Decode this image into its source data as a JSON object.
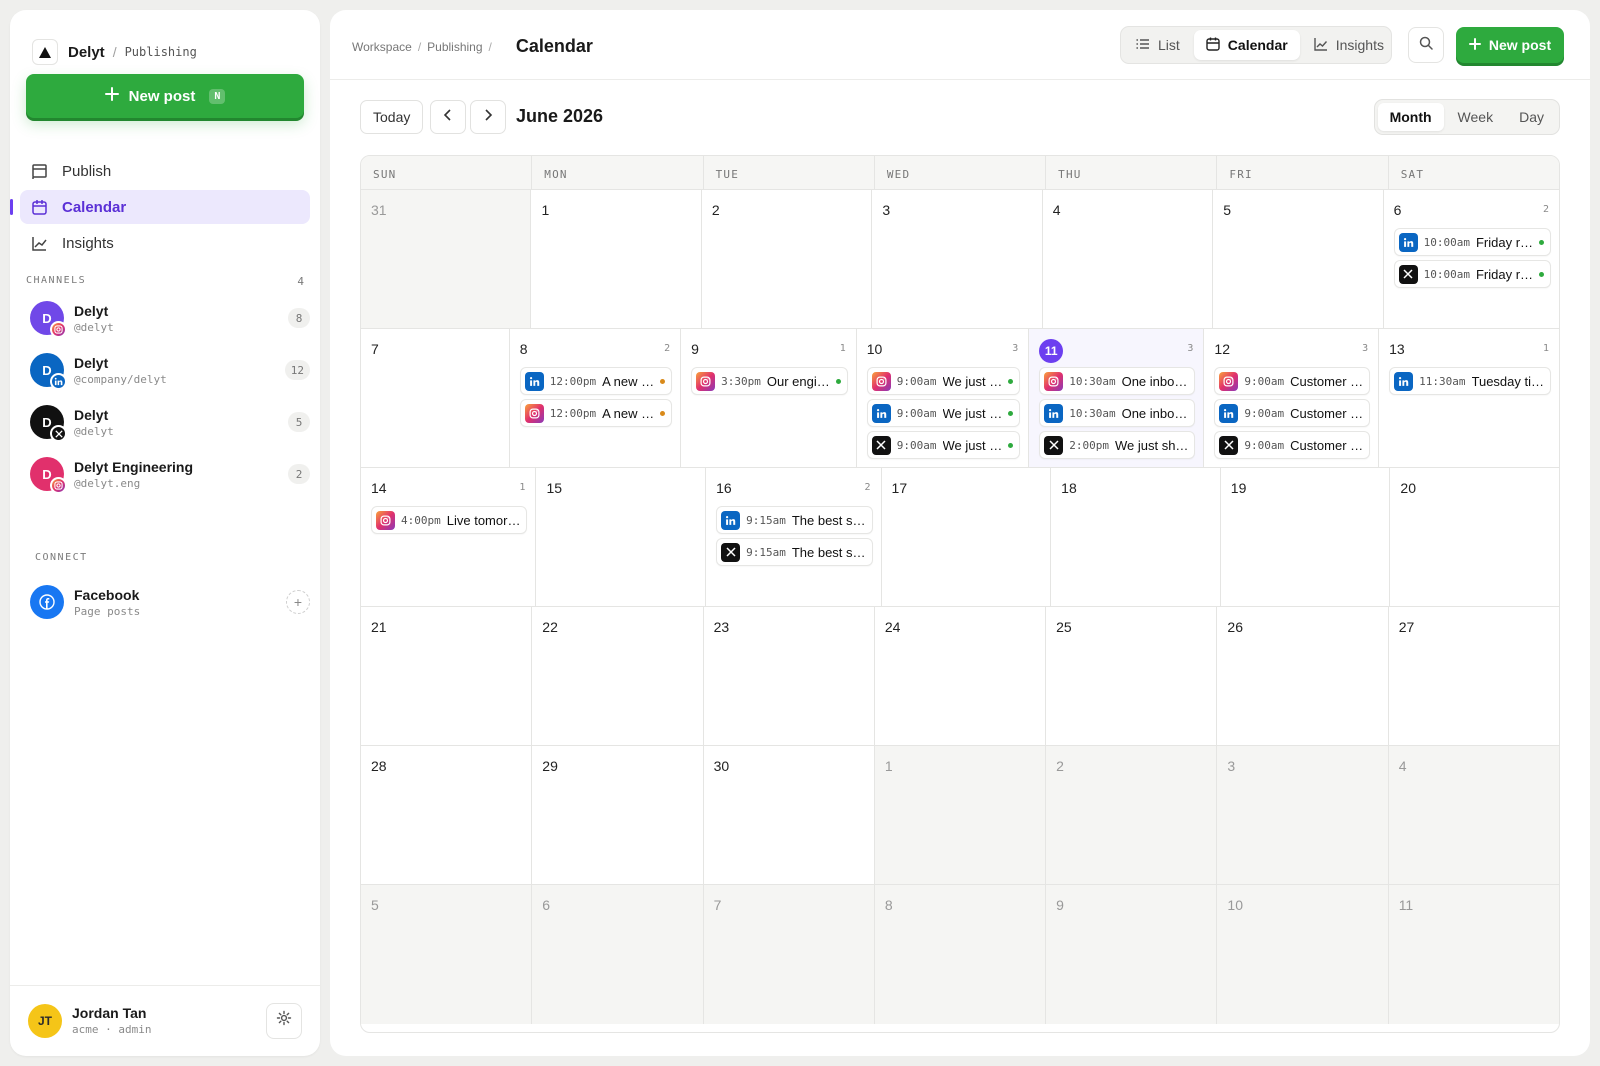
{
  "brand": {
    "name": "Delyt",
    "section": "Publishing"
  },
  "sidebar": {
    "new_post": {
      "label": "New post",
      "shortcut": "N"
    },
    "nav": [
      {
        "label": "Publish",
        "icon": "flag-icon",
        "active": false
      },
      {
        "label": "Calendar",
        "icon": "calendar-icon",
        "active": true
      },
      {
        "label": "Insights",
        "icon": "chart-icon",
        "active": false
      }
    ],
    "channels_label": "CHANNELS",
    "channels_count": "4",
    "channels": [
      {
        "name": "Delyt",
        "handle": "@delyt",
        "count": "8",
        "platform": "instagram",
        "avatar_color": "#7048e8",
        "initial": "D"
      },
      {
        "name": "Delyt",
        "handle": "@company/delyt",
        "count": "12",
        "platform": "linkedin",
        "avatar_color": "#0a66c2",
        "initial": "D"
      },
      {
        "name": "Delyt",
        "handle": "@delyt",
        "count": "5",
        "platform": "x",
        "avatar_color": "#111111",
        "initial": "D"
      },
      {
        "name": "Delyt Engineering",
        "handle": "@delyt.eng",
        "count": "2",
        "platform": "instagram",
        "avatar_color": "#e1306c",
        "initial": "D"
      }
    ],
    "connect_label": "CONNECT",
    "connect": {
      "name": "Facebook",
      "sub": "Page posts"
    },
    "user": {
      "initials": "JT",
      "name": "Jordan Tan",
      "meta": "acme · admin"
    }
  },
  "header": {
    "breadcrumb": [
      "Workspace",
      "Publishing"
    ],
    "title": "Calendar",
    "views": [
      {
        "label": "List",
        "icon": "list-icon",
        "active": false
      },
      {
        "label": "Calendar",
        "icon": "calendar-icon",
        "active": true
      },
      {
        "label": "Insights",
        "icon": "chart-icon",
        "active": false
      }
    ],
    "new_post": "New post"
  },
  "calendar": {
    "today_label": "Today",
    "month_label": "June 2026",
    "ranges": [
      {
        "label": "Month",
        "active": true
      },
      {
        "label": "Week",
        "active": false
      },
      {
        "label": "Day",
        "active": false
      }
    ],
    "weekdays": [
      "SUN",
      "MON",
      "TUE",
      "WED",
      "THU",
      "FRI",
      "SAT"
    ],
    "colors": {
      "accent": "#6c3ff0",
      "green": "#2eaa3e",
      "scheduled": "#2eaa3e",
      "draft": "#d98a1a"
    },
    "weeks": [
      [
        {
          "day": "31",
          "out": true
        },
        {
          "day": "1"
        },
        {
          "day": "2"
        },
        {
          "day": "3"
        },
        {
          "day": "4"
        },
        {
          "day": "5"
        },
        {
          "day": "6",
          "count": "2",
          "posts": [
            {
              "platform": "li",
              "time": "10:00am",
              "text": "Friday r…",
              "status": "green"
            },
            {
              "platform": "x",
              "time": "10:00am",
              "text": "Friday r…",
              "status": "green"
            }
          ]
        }
      ],
      [
        {
          "day": "7"
        },
        {
          "day": "8",
          "count": "2",
          "posts": [
            {
              "platform": "li",
              "time": "12:00pm",
              "text": "A new …",
              "status": "orange"
            },
            {
              "platform": "ig",
              "time": "12:00pm",
              "text": "A new …",
              "status": "orange"
            }
          ]
        },
        {
          "day": "9",
          "count": "1",
          "posts": [
            {
              "platform": "ig",
              "time": "3:30pm",
              "text": "Our engi…",
              "status": "green"
            }
          ]
        },
        {
          "day": "10",
          "count": "3",
          "posts": [
            {
              "platform": "ig",
              "time": "9:00am",
              "text": "We just …",
              "status": "green"
            },
            {
              "platform": "li",
              "time": "9:00am",
              "text": "We just …",
              "status": "green"
            },
            {
              "platform": "x",
              "time": "9:00am",
              "text": "We just …",
              "status": "green"
            }
          ]
        },
        {
          "day": "11",
          "today": true,
          "count": "3",
          "posts": [
            {
              "platform": "ig",
              "time": "10:30am",
              "text": "One inbo…"
            },
            {
              "platform": "li",
              "time": "10:30am",
              "text": "One inbo…"
            },
            {
              "platform": "x",
              "time": "2:00pm",
              "text": "We just sh…"
            }
          ]
        },
        {
          "day": "12",
          "count": "3",
          "posts": [
            {
              "platform": "ig",
              "time": "9:00am",
              "text": "Customer …"
            },
            {
              "platform": "li",
              "time": "9:00am",
              "text": "Customer …"
            },
            {
              "platform": "x",
              "time": "9:00am",
              "text": "Customer …"
            }
          ]
        },
        {
          "day": "13",
          "count": "1",
          "posts": [
            {
              "platform": "li",
              "time": "11:30am",
              "text": "Tuesday ti…"
            }
          ]
        }
      ],
      [
        {
          "day": "14",
          "count": "1",
          "posts": [
            {
              "platform": "ig",
              "time": "4:00pm",
              "text": "Live tomor…"
            }
          ]
        },
        {
          "day": "15"
        },
        {
          "day": "16",
          "count": "2",
          "posts": [
            {
              "platform": "li",
              "time": "9:15am",
              "text": "The best s…"
            },
            {
              "platform": "x",
              "time": "9:15am",
              "text": "The best s…"
            }
          ]
        },
        {
          "day": "17"
        },
        {
          "day": "18"
        },
        {
          "day": "19"
        },
        {
          "day": "20"
        }
      ],
      [
        {
          "day": "21"
        },
        {
          "day": "22"
        },
        {
          "day": "23"
        },
        {
          "day": "24"
        },
        {
          "day": "25"
        },
        {
          "day": "26"
        },
        {
          "day": "27"
        }
      ],
      [
        {
          "day": "28"
        },
        {
          "day": "29"
        },
        {
          "day": "30"
        },
        {
          "day": "1",
          "out": true
        },
        {
          "day": "2",
          "out": true
        },
        {
          "day": "3",
          "out": true
        },
        {
          "day": "4",
          "out": true
        }
      ],
      [
        {
          "day": "5",
          "out": true
        },
        {
          "day": "6",
          "out": true
        },
        {
          "day": "7",
          "out": true
        },
        {
          "day": "8",
          "out": true
        },
        {
          "day": "9",
          "out": true
        },
        {
          "day": "10",
          "out": true
        },
        {
          "day": "11",
          "out": true
        }
      ]
    ]
  }
}
